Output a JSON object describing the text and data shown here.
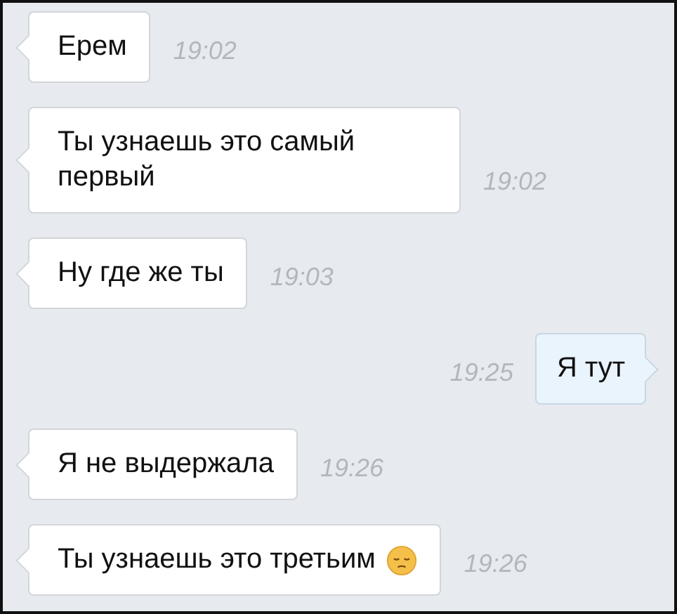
{
  "messages": [
    {
      "text": "Ерем",
      "time": "19:02",
      "outgoing": false,
      "emoji": false
    },
    {
      "text": "Ты узнаешь это самый первый",
      "time": "19:02",
      "outgoing": false,
      "emoji": false
    },
    {
      "text": "Ну где же ты",
      "time": "19:03",
      "outgoing": false,
      "emoji": false
    },
    {
      "text": "Я тут",
      "time": "19:25",
      "outgoing": true,
      "emoji": false
    },
    {
      "text": "Я не выдержала",
      "time": "19:26",
      "outgoing": false,
      "emoji": false
    },
    {
      "text": "Ты узнаешь это третьим",
      "time": "19:26",
      "outgoing": false,
      "emoji": true
    }
  ]
}
